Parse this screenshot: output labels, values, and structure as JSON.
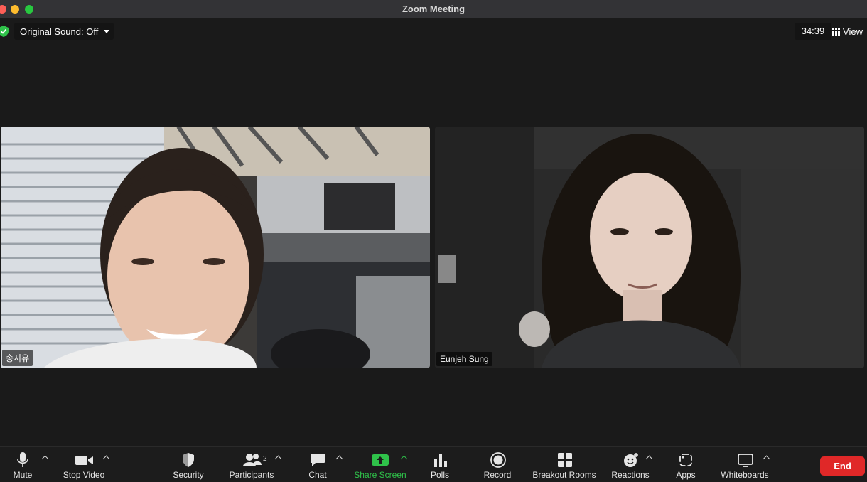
{
  "window": {
    "title": "Zoom Meeting"
  },
  "topbar": {
    "original_sound": "Original Sound: Off",
    "timer": "34:39",
    "view_label": "View"
  },
  "participants": [
    {
      "name": "송지유"
    },
    {
      "name": "Eunjeh Sung"
    }
  ],
  "toolbar": {
    "mute": "Mute",
    "stop_video": "Stop Video",
    "security": "Security",
    "participants": "Participants",
    "participants_count": "2",
    "chat": "Chat",
    "share_screen": "Share Screen",
    "polls": "Polls",
    "record": "Record",
    "breakout_rooms": "Breakout Rooms",
    "reactions": "Reactions",
    "apps": "Apps",
    "whiteboards": "Whiteboards",
    "end": "End"
  },
  "colors": {
    "share_green": "#2fc24a",
    "end_red": "#e02828",
    "shield_green": "#2fc24a"
  }
}
